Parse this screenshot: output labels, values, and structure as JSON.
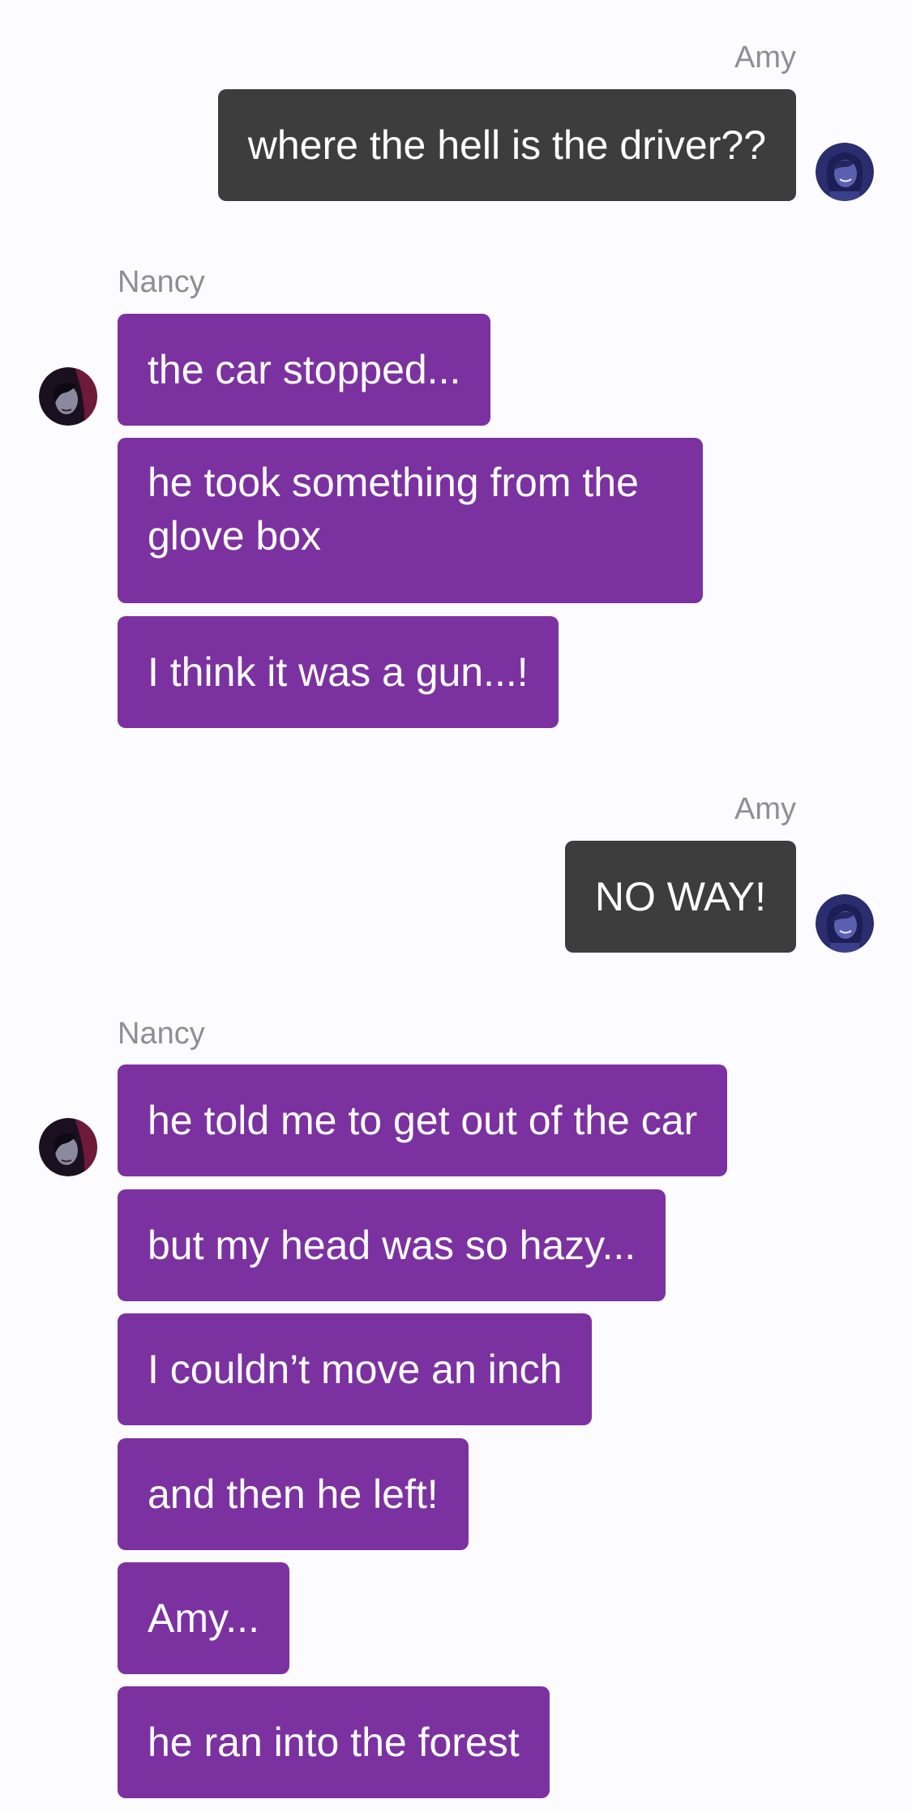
{
  "participants": {
    "amy": {
      "name": "Amy",
      "bubble_color": "#3d3d3d",
      "avatar_icon": "amy-avatar-icon"
    },
    "nancy": {
      "name": "Nancy",
      "bubble_color": "#7b32a0",
      "avatar_icon": "nancy-avatar-icon"
    }
  },
  "groups": [
    {
      "sender": "Amy",
      "messages": [
        "where the hell is the driver??"
      ]
    },
    {
      "sender": "Nancy",
      "messages": [
        "the car stopped...",
        "he took something from the glove box",
        "I think it was a gun...!"
      ]
    },
    {
      "sender": "Amy",
      "messages": [
        "NO WAY!"
      ]
    },
    {
      "sender": "Nancy",
      "messages": [
        "he told me to get out of the car",
        "but my head was so hazy...",
        "I couldn’t move an inch",
        "and then he left!",
        "Amy...",
        "he ran into the forest"
      ]
    }
  ]
}
